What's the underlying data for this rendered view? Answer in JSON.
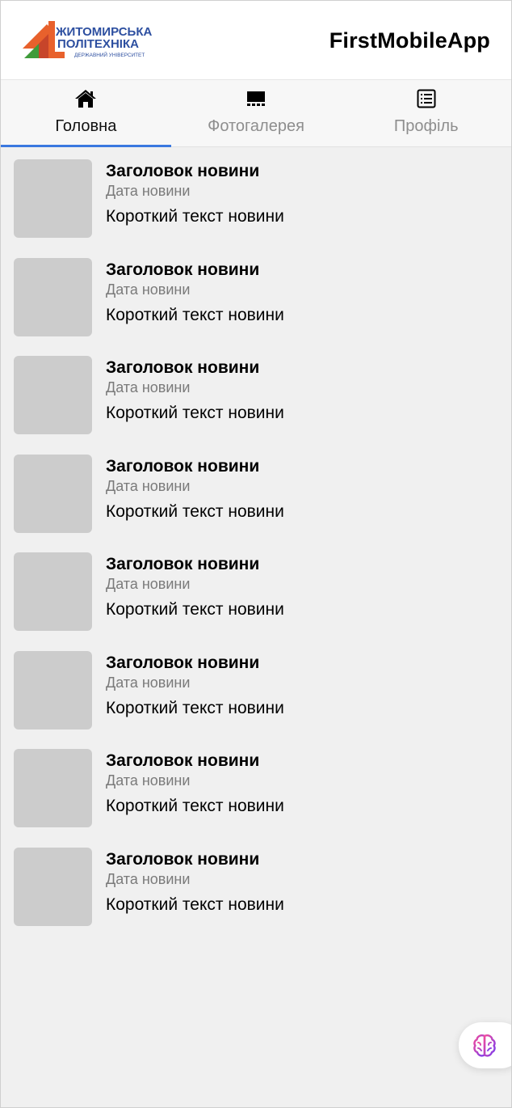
{
  "header": {
    "logo": {
      "line1": "ЖИТОМИРСЬКА",
      "line2": "ПОЛІТЕХНІКА",
      "line3": "ДЕРЖАВНИЙ УНІВЕРСИТЕТ"
    },
    "app_title": "FirstMobileApp"
  },
  "tabs": [
    {
      "label": "Головна",
      "icon": "home-icon",
      "active": true
    },
    {
      "label": "Фотогалерея",
      "icon": "gallery-icon",
      "active": false
    },
    {
      "label": "Профіль",
      "icon": "list-icon",
      "active": false
    }
  ],
  "news": [
    {
      "title": "Заголовок новини",
      "date": "Дата новини",
      "text": "Короткий текст новини"
    },
    {
      "title": "Заголовок новини",
      "date": "Дата новини",
      "text": "Короткий текст новини"
    },
    {
      "title": "Заголовок новини",
      "date": "Дата новини",
      "text": "Короткий текст новини"
    },
    {
      "title": "Заголовок новини",
      "date": "Дата новини",
      "text": "Короткий текст новини"
    },
    {
      "title": "Заголовок новини",
      "date": "Дата новини",
      "text": "Короткий текст новини"
    },
    {
      "title": "Заголовок новини",
      "date": "Дата новини",
      "text": "Короткий текст новини"
    },
    {
      "title": "Заголовок новини",
      "date": "Дата новини",
      "text": "Короткий текст новини"
    },
    {
      "title": "Заголовок новини",
      "date": "Дата новини",
      "text": "Короткий текст новини"
    }
  ],
  "colors": {
    "accent": "#3a78e0",
    "logo_orange": "#e8612c",
    "logo_green": "#3f9b3a",
    "logo_blue": "#2d4fa0",
    "thumb_placeholder": "#cccccc",
    "background": "#f0f0f0"
  },
  "floating_button": {
    "icon": "brain-icon"
  }
}
